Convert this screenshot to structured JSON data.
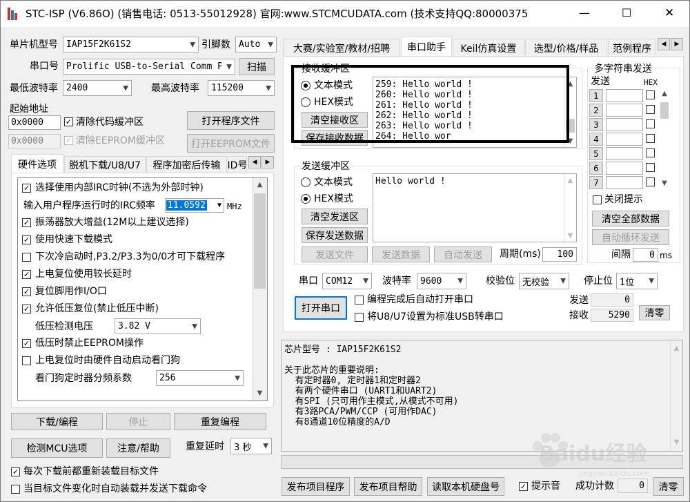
{
  "title": "STC-ISP (V6.86O) (销售电话: 0513-55012928) 官网:www.STCMCUDATA.com (技术支持QQ:800003751) STC:宏晶科技",
  "titlebar": {
    "minimize": "—",
    "maximize": "☐",
    "close": "✕"
  },
  "left": {
    "mcu_label": "单片机型号",
    "mcu_value": "IAP15F2K61S2",
    "pins_label": "引脚数",
    "pins_value": "Auto",
    "port_label": "串口号",
    "port_value": "Prolific USB-to-Serial Comm Port",
    "scan": "扫描",
    "min_baud_label": "最低波特率",
    "min_baud": "2400",
    "max_baud_label": "最高波特率",
    "max_baud": "115200",
    "start_label": "起始地址",
    "addr1": "0x0000",
    "clear_code": "清除代码缓冲区",
    "open_prog": "打开程序文件",
    "addr2": "0x0000",
    "clear_eeprom": "清除EEPROM缓冲区",
    "open_eeprom": "打开EEPROM文件",
    "tabs": [
      "硬件选项",
      "脱机下载/U8/U7",
      "程序加密后传输",
      "ID号"
    ],
    "opt1": "选择使用内部IRC时钟(不选为外部时钟)",
    "freq_label": "输入用户程序运行时的IRC频率",
    "freq_value": "11.0592",
    "freq_unit": "MHz",
    "opt2": "振荡器放大增益(12M以上建议选择)",
    "opt3": "使用快速下载模式",
    "opt4": "下次冷启动时,P3.2/P3.3为0/0才可下载程序",
    "opt5": "上电复位使用较长延时",
    "opt6": "复位脚用作I/O口",
    "opt7": "允许低压复位(禁止低压中断)",
    "lv_label": "低压检测电压",
    "lv_value": "3.82 V",
    "opt8": "低压时禁止EEPROM操作",
    "opt9": "上电复位时由硬件自动启动看门狗",
    "wd_label": "看门狗定时器分频系数",
    "wd_value": "256",
    "download": "下载/编程",
    "stop": "停止",
    "reprog": "重复编程",
    "detect": "检测MCU选项",
    "help": "注意/帮助",
    "delay_label": "重复延时",
    "delay_value": "3 秒",
    "reload": "每次下载前都重新装载目标文件",
    "autoload": "当目标文件变化时自动装载并发送下载命令"
  },
  "right": {
    "tabs": [
      "大赛/实验室/教材/招聘",
      "串口助手",
      "Keil仿真设置",
      "选型/价格/样品",
      "范例程序"
    ],
    "recv_group": "接收缓冲区",
    "text_mode": "文本模式",
    "hex_mode": "HEX模式",
    "clear_recv": "清空接收区",
    "save_recv": "保存接收数据",
    "recv_lines": [
      "259: Hello world !",
      "260: Hello world !",
      "261: Hello world !",
      "262: Hello world !",
      "263: Hello world !",
      "264: Hello wor"
    ],
    "send_group": "发送缓冲区",
    "send_text": "Hello world !",
    "clear_send": "清空发送区",
    "save_send": "保存发送数据",
    "send_file": "发送文件",
    "send_data": "发送数据",
    "auto_send": "自动发送",
    "period_label": "周期(ms)",
    "period_value": "100",
    "multi_title": "多字符串发送",
    "multi_send": "发送",
    "multi_hex": "HEX",
    "rows": [
      "1",
      "2",
      "3",
      "4",
      "5",
      "6",
      "7"
    ],
    "close_hint": "关闭提示",
    "clear_all": "清空全部数据",
    "auto_loop": "自动循环发送",
    "interval_label": "间隔",
    "interval_value": "0",
    "interval_unit": "ms",
    "com_label": "串口",
    "com_value": "COM12",
    "baud_label": "波特率",
    "baud_value": "9600",
    "check_label": "校验位",
    "check_value": "无校验",
    "stop_label": "停止位",
    "stop_value": "1位",
    "open_port": "打开串口",
    "opt_auto_open": "编程完成后自动打开串口",
    "opt_usb": "将U8/U7设置为标准USB转串口",
    "sent_label": "发送",
    "sent_value": "0",
    "recv_label": "接收",
    "recv_value": "5290",
    "clear_count": "清零",
    "info_lines": [
      "芯片型号 : IAP15F2K61S2",
      "",
      "关于此芯片的重要说明:",
      "  有定时器0, 定时器1和定时器2",
      "  有两个硬件串口 (UART1和UART2)",
      "  有SPI (只可用作主模式,从模式不可用)",
      "  有3路PCA/PWM/CCP (可用作DAC)",
      "  有8通道10位精度的A/D"
    ],
    "publish": "发布项目程序",
    "publish_help": "发布项目帮助",
    "read_disk": "读取本机硬盘号",
    "beep": "提示音",
    "success_label": "成功计数",
    "success_value": "0",
    "clear_success": "清零"
  },
  "watermark": "Baidu经验",
  "watermark_url": "jingyan.baidu.com"
}
